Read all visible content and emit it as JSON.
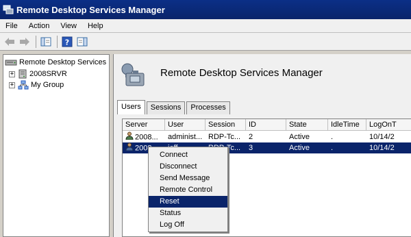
{
  "window": {
    "title": "Remote Desktop Services Manager"
  },
  "menu": [
    "File",
    "Action",
    "View",
    "Help"
  ],
  "toolbar": {
    "buttons": [
      "back-icon",
      "forward-icon",
      "show-hide-tree-icon",
      "help-icon",
      "show-hide-action-pane-icon"
    ]
  },
  "tree": {
    "root": "Remote Desktop Services Manager",
    "root_display": "Remote Desktop Services M",
    "children": [
      {
        "label": "2008SRVR",
        "expander": "+"
      },
      {
        "label": "My Group",
        "expander": "+"
      }
    ]
  },
  "details": {
    "title": "Remote Desktop Services Manager",
    "tabs": [
      "Users",
      "Sessions",
      "Processes"
    ],
    "active_tab": "Users",
    "columns": [
      "Server",
      "User",
      "Session",
      "ID",
      "State",
      "IdleTime",
      "LogOnT"
    ],
    "rows": [
      {
        "server": "2008...",
        "user": "administ...",
        "session": "RDP-Tc...",
        "id": "2",
        "state": "Active",
        "idle": ".",
        "logon": "10/14/2",
        "selected": false
      },
      {
        "server": "2008...",
        "user": "jeff",
        "session": "RDP-Tc...",
        "id": "3",
        "state": "Active",
        "idle": ".",
        "logon": "10/14/2",
        "selected": true
      }
    ]
  },
  "context_menu": {
    "items": [
      "Connect",
      "Disconnect",
      "Send Message",
      "Remote Control",
      "Reset",
      "Status",
      "Log Off"
    ],
    "highlighted": "Reset"
  },
  "colors": {
    "titlebar": "#0a246a",
    "selection": "#0a246a"
  }
}
